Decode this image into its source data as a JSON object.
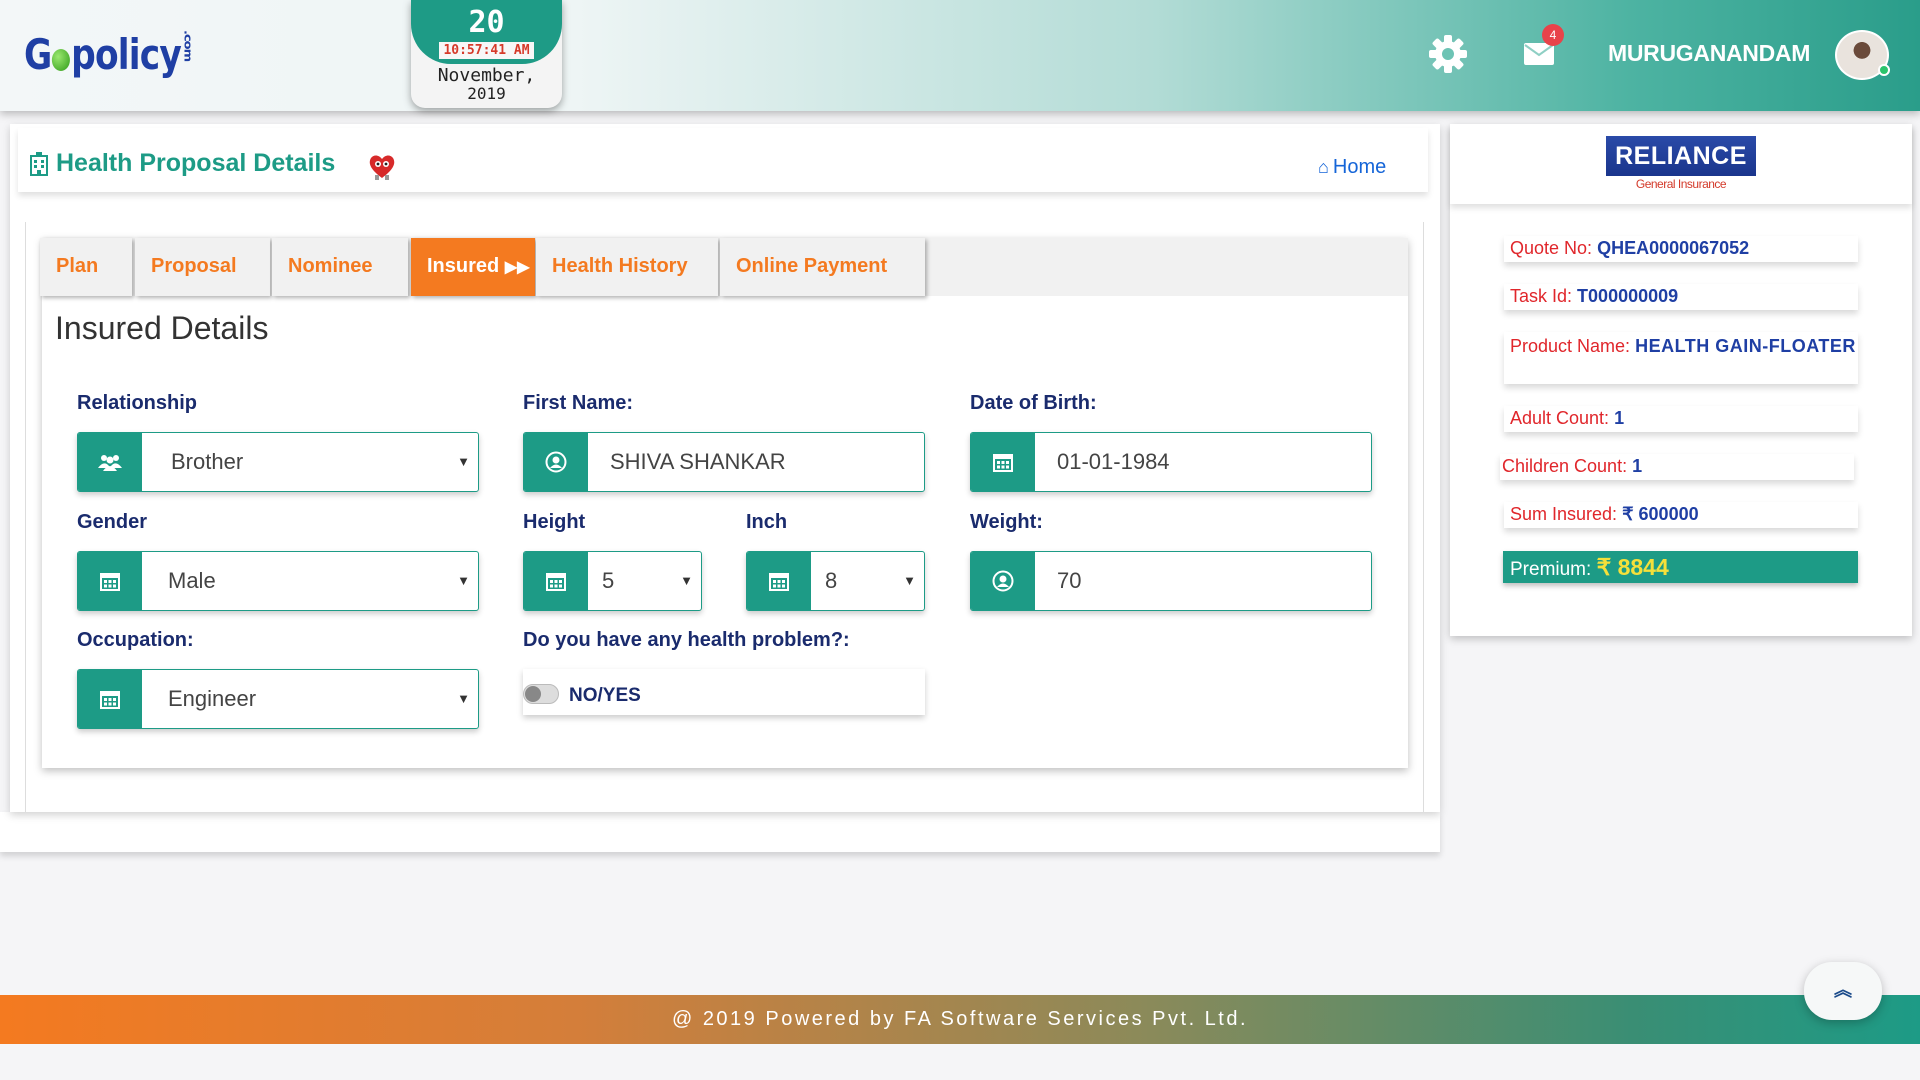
{
  "header": {
    "logo_text": "Gopolicy",
    "logo_suffix": ".com",
    "clock": {
      "day": "20",
      "time": "10:57:41 AM",
      "month": "November,",
      "year": "2019"
    },
    "notification_count": "4",
    "username": "MURUGANANDAM"
  },
  "page": {
    "title": "Health Proposal Details",
    "home_link": "Home"
  },
  "tabs": [
    {
      "label": "Plan"
    },
    {
      "label": "Proposal"
    },
    {
      "label": "Nominee"
    },
    {
      "label": "Insured",
      "active": true
    },
    {
      "label": "Health History"
    },
    {
      "label": "Online Payment"
    }
  ],
  "form": {
    "section_title": "Insured Details",
    "relationship": {
      "label": "Relationship",
      "value": "Brother"
    },
    "first_name": {
      "label": "First Name:",
      "value": "SHIVA SHANKAR"
    },
    "dob": {
      "label": "Date of Birth:",
      "value": "01-01-1984"
    },
    "gender": {
      "label": "Gender",
      "value": "Male"
    },
    "height": {
      "label": "Height",
      "value": "5"
    },
    "inch": {
      "label": "Inch",
      "value": "8"
    },
    "weight": {
      "label": "Weight:",
      "value": "70"
    },
    "occupation": {
      "label": "Occupation:",
      "value": "Engineer"
    },
    "health_problem": {
      "label": "Do you have any health problem?:",
      "toggle_label": "NO/YES",
      "checked": false
    }
  },
  "summary": {
    "insurer_name": "RELIANCE",
    "insurer_sub": "General Insurance",
    "quote_no": {
      "label": "Quote No:",
      "value": "QHEA0000067052"
    },
    "task_id": {
      "label": "Task Id:",
      "value": "T000000009"
    },
    "product_name": {
      "label": "Product Name:",
      "value": "HEALTH GAIN-FLOATER"
    },
    "adult_count": {
      "label": "Adult Count:",
      "value": "1"
    },
    "children_count": {
      "label": "Children Count:",
      "value": "1"
    },
    "sum_insured": {
      "label": "Sum Insured:",
      "value": "₹ 600000"
    },
    "premium": {
      "label": "Premium:",
      "value": "₹ 8844"
    }
  },
  "footer": {
    "text": "@ 2019 Powered by FA Software Services Pvt. Ltd."
  },
  "colors": {
    "primary": "#1d9b86",
    "accent": "#f47a20",
    "navy": "#1a2b6d",
    "red": "#e0262b"
  },
  "icons": [
    "settings-gear-icon",
    "mail-icon",
    "hospital-icon",
    "heart-mascot-icon",
    "home-icon",
    "users-icon",
    "user-circle-icon",
    "calendar-icon",
    "double-chevron-right-icon",
    "chevron-up-icon"
  ]
}
